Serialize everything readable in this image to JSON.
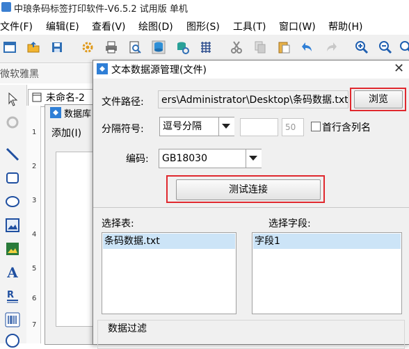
{
  "app": {
    "title": "中琅条码标签打印软件-V6.5.2 试用版 单机"
  },
  "menu": [
    "文件(F)",
    "编辑(E)",
    "查看(V)",
    "绘图(D)",
    "图形(S)",
    "工具(T)",
    "窗口(W)",
    "帮助(H)"
  ],
  "toolbar": {
    "icons": [
      "new-icon",
      "open-icon",
      "save-icon",
      "settings-icon",
      "print-icon",
      "print-preview-icon",
      "database-icon",
      "db-settings-icon",
      "grid-icon",
      "cut-icon",
      "copy-icon",
      "paste-icon",
      "undo-icon",
      "redo-icon",
      "zoom-in-icon",
      "zoom-out-icon",
      "zoom-fit-icon"
    ]
  },
  "font_bar": {
    "font": "微软雅黑"
  },
  "document": {
    "tab_label": "未命名-2"
  },
  "bg_window": {
    "title": "数据库",
    "add_label": "添加(I)"
  },
  "ruler": {
    "numbers": [
      "1",
      "2",
      "3",
      "4",
      "5",
      "6",
      "7"
    ]
  },
  "dialog": {
    "title": "文本数据源管理(文件)",
    "file_path_label": "文件路径:",
    "file_path_value": "ers\\Administrator\\Desktop\\条码数据.txt",
    "browse_label": "浏览",
    "separator_label": "分隔符号:",
    "separator_value": "逗号分隔",
    "separator_custom": "",
    "separator_width": "50",
    "header_checkbox_label": "首行含列名",
    "encoding_label": "编码:",
    "encoding_value": "GB18030",
    "test_button_label": "测试连接",
    "select_table_label": "选择表:",
    "select_field_label": "选择字段:",
    "tables": [
      "条码数据.txt"
    ],
    "fields": [
      "字段1"
    ],
    "filter_label": "数据过滤"
  },
  "colors": {
    "highlight_box": "#e0282e",
    "selection": "#cce4f7",
    "app_blue": "#3b7fd1"
  }
}
